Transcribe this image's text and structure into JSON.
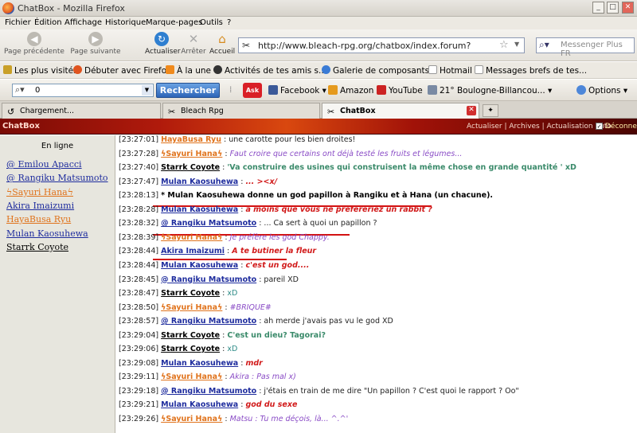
{
  "window": {
    "title": "ChatBox - Mozilla Firefox",
    "controls": [
      "_",
      "□",
      "✕"
    ]
  },
  "menu": [
    "Fichier",
    "Édition",
    "Affichage",
    "Historique",
    "Marque-pages",
    "Outils",
    "?"
  ],
  "nav": {
    "back_label": "Page précédente",
    "forward_label": "Page suivante",
    "reload_label": "Actualiser",
    "stop_label": "Arrêter",
    "home_label": "Accueil",
    "url": "http://www.bleach-rpg.org/chatbox/index.forum?",
    "search_placeholder": "Messenger Plus FR"
  },
  "bookmarks": [
    {
      "label": "Les plus visités",
      "icon": "bookmark-icon",
      "color": "#c9a028"
    },
    {
      "label": "Débuter avec Firefox",
      "icon": "firefox-icon",
      "color": "#e0541f"
    },
    {
      "label": "À la une",
      "icon": "rss-icon",
      "color": "#f08a1c"
    },
    {
      "label": "Activités de tes amis s...",
      "icon": "friends-icon",
      "color": "#333333"
    },
    {
      "label": "Galerie de composants...",
      "icon": "gallery-icon",
      "color": "#3a7bd5"
    },
    {
      "label": "Hotmail",
      "icon": "page-icon",
      "color": "#bfbfbf"
    },
    {
      "label": "Messages brefs de tes...",
      "icon": "page-icon",
      "color": "#bfbfbf"
    }
  ],
  "toolbar2": {
    "search_value": "0",
    "search_button": "Rechercher",
    "ask_label": "Ask",
    "items": [
      {
        "label": "Facebook",
        "icon": "facebook-icon",
        "color": "#3b5998"
      },
      {
        "label": "Amazon",
        "icon": "amazon-icon",
        "color": "#e59a1d"
      },
      {
        "label": "YouTube",
        "icon": "youtube-icon",
        "color": "#cc2222"
      },
      {
        "label": "21° Boulogne-Billancou...",
        "icon": "weather-icon",
        "color": "#7a8aa3"
      }
    ],
    "options_label": "Options"
  },
  "tabs": [
    {
      "label": "Chargement...",
      "icon": "loading-icon"
    },
    {
      "label": "Bleach Rpg",
      "icon": "bleach-icon"
    },
    {
      "label": "ChatBox",
      "icon": "bleach-icon"
    }
  ],
  "chatbox": {
    "header_title": "ChatBox",
    "header_links": "Actualiser | Archives | Actualisation auto",
    "header_check": "✓",
    "header_disconnect": "Déconne",
    "online_title": "En ligne",
    "online_users": [
      {
        "name": "@ Emilou Apacci",
        "color": "#1f2d9e"
      },
      {
        "name": "@ Rangiku Matsumoto",
        "color": "#1f2d9e"
      },
      {
        "name": "ϟSayuri Hanaϟ",
        "color": "#e0731c"
      },
      {
        "name": "Akira Imaizumi",
        "color": "#1f2d9e"
      },
      {
        "name": "HayaBusa Ryu",
        "color": "#e0731c"
      },
      {
        "name": "Mulan Kaosuhewa",
        "color": "#1f2d9e"
      },
      {
        "name": "Starrk Coyote",
        "color": "#000000"
      }
    ],
    "messages": [
      {
        "ts": "[23:27:01]",
        "user": "HayaBusa Ryu",
        "user_class": "u-orange",
        "text": "une carotte pour les bien droites!",
        "text_class": "t-black"
      },
      {
        "ts": "[23:27:28]",
        "user": "ϟSayuri Hanaϟ",
        "user_class": "u-orange",
        "text": "Faut croire que certains ont déjà testé les fruits et légumes...",
        "text_class": "t-purple"
      },
      {
        "ts": "[23:27:40]",
        "user": "Starrk Coyote",
        "user_class": "u-black",
        "text": "'Va construire des usines qui construisent la même chose en grande quantité ' xD",
        "text_class": "t-green"
      },
      {
        "ts": "[23:27:47]",
        "user": "Mulan Kaosuhewa",
        "user_class": "u-blue",
        "text": "... ><x/",
        "text_class": "t-red"
      },
      {
        "ts": "[23:28:13]",
        "user": "",
        "user_class": "u-black",
        "text": "* Mulan Kaosuhewa donne un god papillon à Rangiku et à Hana (un chacune).",
        "text_class": "t-bold"
      },
      {
        "ts": "[23:28:28]",
        "user": "Mulan Kaosuhewa",
        "user_class": "u-blue",
        "text": "à moins que vous ne préfèreriez un rabbit ?",
        "text_class": "t-red"
      },
      {
        "ts": "[23:28:32]",
        "user": "@ Rangiku Matsumoto",
        "user_class": "u-blue",
        "text": "... Ca sert à quoi un papillon ?",
        "text_class": "t-black"
      },
      {
        "ts": "[23:28:39]",
        "user": "ϟSayuri Hanaϟ",
        "user_class": "u-orange",
        "text": "Je préfère les god Chappy.",
        "text_class": "t-purple"
      },
      {
        "ts": "[23:28:44]",
        "user": "Akira Imaizumi",
        "user_class": "u-blue",
        "text": "A te butiner la fleur",
        "text_class": "t-red"
      },
      {
        "ts": "[23:28:44]",
        "user": "Mulan Kaosuhewa",
        "user_class": "u-blue",
        "text": "c'est un god....",
        "text_class": "t-red"
      },
      {
        "ts": "[23:28:45]",
        "user": "@ Rangiku Matsumoto",
        "user_class": "u-blue",
        "text": "pareil XD",
        "text_class": "t-black"
      },
      {
        "ts": "[23:28:47]",
        "user": "Starrk Coyote",
        "user_class": "u-black",
        "text": "xD",
        "text_class": "t-teal"
      },
      {
        "ts": "[23:28:50]",
        "user": "ϟSayuri Hanaϟ",
        "user_class": "u-orange",
        "text": "#BRIQUE#",
        "text_class": "t-purple"
      },
      {
        "ts": "[23:28:57]",
        "user": "@ Rangiku Matsumoto",
        "user_class": "u-blue",
        "text": "ah merde j'avais pas vu le god XD",
        "text_class": "t-black"
      },
      {
        "ts": "[23:29:04]",
        "user": "Starrk Coyote",
        "user_class": "u-black",
        "text": "C'est un dieu? Tagorai?",
        "text_class": "t-green"
      },
      {
        "ts": "[23:29:06]",
        "user": "Starrk Coyote",
        "user_class": "u-black",
        "text": "xD",
        "text_class": "t-teal"
      },
      {
        "ts": "[23:29:08]",
        "user": "Mulan Kaosuhewa",
        "user_class": "u-blue",
        "text": "mdr",
        "text_class": "t-red"
      },
      {
        "ts": "[23:29:11]",
        "user": "ϟSayuri Hanaϟ",
        "user_class": "u-orange",
        "text": "Akira : Pas mal x)",
        "text_class": "t-purple"
      },
      {
        "ts": "[23:29:18]",
        "user": "@ Rangiku Matsumoto",
        "user_class": "u-blue",
        "text": "j'étais en train de me dire \"Un papillon ? C'est quoi le rapport ? Oo\"",
        "text_class": "t-black"
      },
      {
        "ts": "[23:29:21]",
        "user": "Mulan Kaosuhewa",
        "user_class": "u-blue",
        "text": "god du sexe",
        "text_class": "t-red"
      },
      {
        "ts": "[23:29:26]",
        "user": "ϟSayuri Hanaϟ",
        "user_class": "u-orange",
        "text": "Matsu : Tu me déçois, là... ^.^'",
        "text_class": "t-purple"
      }
    ]
  }
}
